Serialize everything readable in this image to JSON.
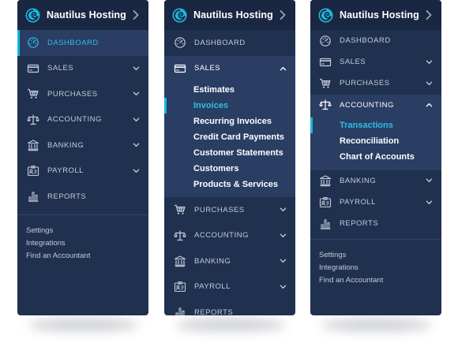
{
  "colors": {
    "panel_bg": "#20304f",
    "header_bg": "#1a2742",
    "active_bg": "#2a3d63",
    "accent": "#14b8e0",
    "text": "#c3cbd9",
    "text_bright": "#ffffff"
  },
  "brand": {
    "name": "Nautilus Hosting",
    "logo_icon": "nautilus-logo-icon",
    "collapse_icon": "chevron-right-icon"
  },
  "panel1": {
    "items": [
      {
        "label": "DASHBOARD",
        "icon": "dashboard-gauge-icon"
      },
      {
        "label": "SALES",
        "icon": "credit-card-icon"
      },
      {
        "label": "PURCHASES",
        "icon": "shopping-cart-icon"
      },
      {
        "label": "ACCOUNTING",
        "icon": "scales-icon"
      },
      {
        "label": "BANKING",
        "icon": "bank-icon"
      },
      {
        "label": "PAYROLL",
        "icon": "payroll-id-icon"
      },
      {
        "label": "REPORTS",
        "icon": "bar-chart-icon"
      }
    ],
    "footer": [
      "Settings",
      "Integrations",
      "Find an Accountant"
    ]
  },
  "panel2": {
    "items": [
      {
        "label": "DASHBOARD"
      },
      {
        "label": "SALES"
      },
      {
        "label": "PURCHASES"
      },
      {
        "label": "ACCOUNTING"
      },
      {
        "label": "BANKING"
      },
      {
        "label": "PAYROLL"
      },
      {
        "label": "REPORTS"
      }
    ],
    "sales_submenu": [
      "Estimates",
      "Invoices",
      "Recurring Invoices",
      "Credit Card Payments",
      "Customer Statements",
      "Customers",
      "Products & Services"
    ]
  },
  "panel3": {
    "items": [
      {
        "label": "DASHBOARD"
      },
      {
        "label": "SALES"
      },
      {
        "label": "PURCHASES"
      },
      {
        "label": "ACCOUNTING"
      },
      {
        "label": "BANKING"
      },
      {
        "label": "PAYROLL"
      },
      {
        "label": "REPORTS"
      }
    ],
    "accounting_submenu": [
      "Transactions",
      "Reconciliation",
      "Chart of Accounts"
    ],
    "footer": [
      "Settings",
      "Integrations",
      "Find an Accountant"
    ]
  }
}
